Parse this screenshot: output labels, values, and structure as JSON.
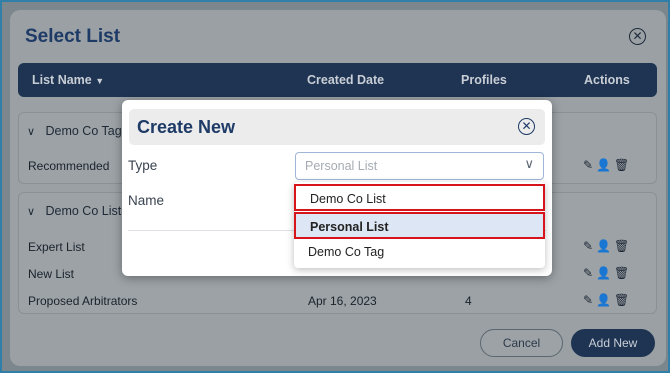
{
  "select_list_modal": {
    "title": "Select List",
    "table_headers": [
      "List Name",
      "Created Date",
      "Profiles",
      "Actions"
    ],
    "sort_indicator": "▼",
    "groups": [
      {
        "name": "Demo Co Tags",
        "rows": [
          {
            "name": "Recommended",
            "date": "",
            "profiles": ""
          }
        ]
      },
      {
        "name": "Demo Co Lists",
        "rows": [
          {
            "name": "Expert List",
            "date": "",
            "profiles": ""
          },
          {
            "name": "New List",
            "date": "",
            "profiles": ""
          },
          {
            "name": "Proposed Arbitrators",
            "date": "Apr 16, 2023",
            "profiles": "4"
          }
        ]
      }
    ],
    "buttons": {
      "cancel": "Cancel",
      "add_new": "Add New"
    }
  },
  "create_new_dialog": {
    "title": "Create New",
    "type_label": "Type",
    "name_label": "Name",
    "type_select_value": "Personal List",
    "dropdown_options": [
      "Demo Co List",
      "Personal List",
      "Demo Co Tag"
    ],
    "selected_option": "Personal List"
  },
  "colors": {
    "header_bg": "#1e3452",
    "title_color": "#1e3a66",
    "highlight_border": "#d7141c",
    "selected_option_bg": "#dde6f4"
  }
}
